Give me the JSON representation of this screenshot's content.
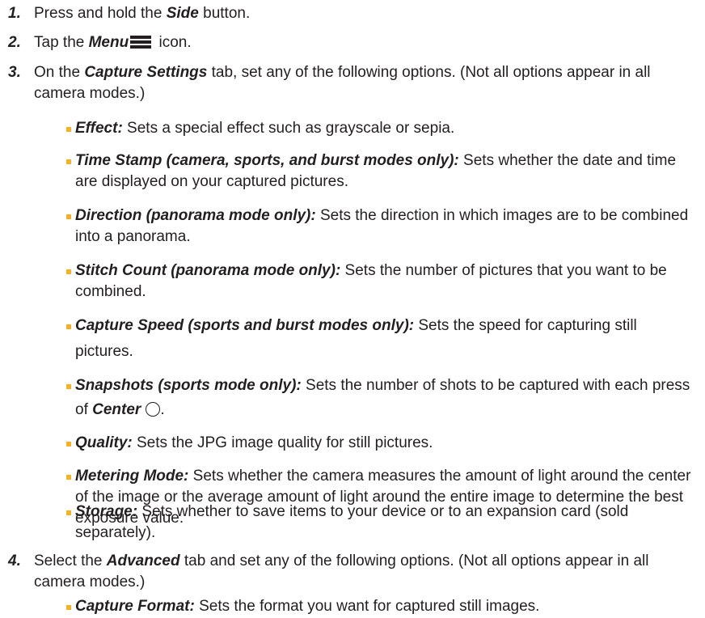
{
  "steps": [
    {
      "num": "1.",
      "pre": "Press and hold the ",
      "em": "Side",
      "post": " button."
    },
    {
      "num": "2.",
      "pre": "Tap the ",
      "em": "Menu",
      "post": " icon.",
      "icon": "menu-icon"
    },
    {
      "num": "3.",
      "pre": "On the ",
      "em": "Capture Settings",
      "post": " tab, set any of the following options. (Not all options appear in all camera modes.)"
    },
    {
      "num": "4.",
      "pre": "Select the ",
      "em": "Advanced",
      "post": " tab and set any of the following options. (Not all options appear in all camera modes.)"
    }
  ],
  "step3_options": [
    {
      "label": "Effect:",
      "desc": " Sets a special effect such as grayscale or sepia."
    },
    {
      "label": "Time Stamp (camera, sports, and burst modes only):",
      "desc": " Sets whether the date and time are displayed on your captured pictures."
    },
    {
      "label": "Direction (panorama mode only):",
      "desc": " Sets the direction in which images are to be combined into a panorama."
    },
    {
      "label": "Stitch Count (panorama mode only):",
      "desc": " Sets the number of pictures that you want to be combined."
    },
    {
      "label": "Capture Speed (sports and burst modes only):",
      "desc": " Sets the speed for capturing still pictures."
    },
    {
      "label": "Snapshots (sports mode only):",
      "desc": " Sets the number of shots to be captured with each press of ",
      "tail_em": "Center",
      "icon": "circle-icon",
      "tail": "."
    },
    {
      "label": "Quality:",
      "desc": " Sets the JPG image quality for still pictures."
    },
    {
      "label": "Metering Mode:",
      "desc": " Sets whether the camera measures the amount of light around the center of the image or the average amount of light around the entire image to determine the best exposure value."
    },
    {
      "label": "Storage:",
      "desc": " Sets whether to save items to your device or to an expansion card (sold separately)."
    }
  ],
  "step4_options": [
    {
      "label": "Capture Format:",
      "desc": " Sets the format you want for captured still images."
    }
  ],
  "colors": {
    "bullet": "#f2b126",
    "text": "#231f20"
  }
}
